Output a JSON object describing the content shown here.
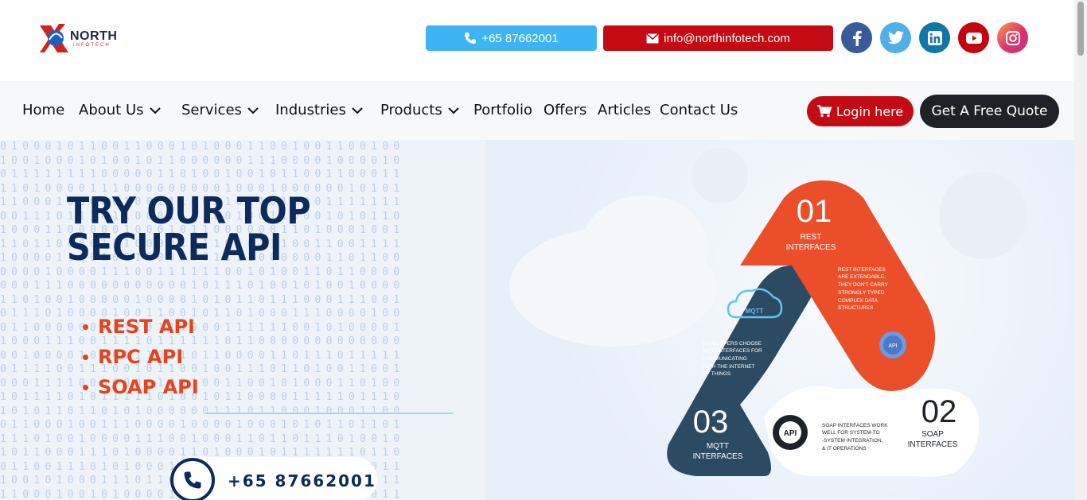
{
  "brand": {
    "logo_name": "NORTH",
    "logo_sub": "INFOTECH"
  },
  "contact": {
    "phone": "+65 87662001",
    "email": "info@northinfotech.com"
  },
  "social": [
    "facebook-icon",
    "twitter-icon",
    "linkedin-icon",
    "youtube-icon",
    "instagram-icon"
  ],
  "nav": {
    "items": [
      {
        "label": "Home",
        "dropdown": false
      },
      {
        "label": "About Us",
        "dropdown": true
      },
      {
        "label": "Services",
        "dropdown": true
      },
      {
        "label": "Industries",
        "dropdown": true
      },
      {
        "label": "Products",
        "dropdown": true
      },
      {
        "label": "Portfolio",
        "dropdown": false
      },
      {
        "label": "Offers",
        "dropdown": false
      },
      {
        "label": "Articles",
        "dropdown": false
      },
      {
        "label": "Contact Us",
        "dropdown": false
      }
    ],
    "login_label": "Login here",
    "quote_label": "Get A Free Quote"
  },
  "hero": {
    "title_line1": "TRY OUR TOP",
    "title_line2": "SECURE API",
    "api_list": [
      "REST API",
      "RPC API",
      "SOAP API"
    ],
    "phone": "+65 87662001",
    "infographic": {
      "step1": {
        "number": "01",
        "title_line1": "REST",
        "title_line2": "INTERFACES",
        "desc": [
          "REST INTERFACES",
          "ARE EXTENDABLE,",
          "THEY DON'T CARRY",
          "STRONGLY TYPED",
          "COMPLEX DATA",
          "STRUCTURES"
        ],
        "badge": "API"
      },
      "step2": {
        "number": "02",
        "title_line1": "SOAP",
        "title_line2": "INTERFACES",
        "desc": [
          "SOAP INTERFACES WORK",
          "WELL FOR SYSTEM-TO",
          "-SYSTEM INTEGRATION,",
          "& IT OPERATIONS"
        ],
        "badge": "API"
      },
      "step3": {
        "number": "03",
        "title_line1": "MQTT",
        "title_line2": "INTERFACES",
        "desc": [
          "DEVELOPERS CHOOSE",
          "MQTTINTERFACES FOR",
          "COMMUNICATING",
          "WITH THE INTERNET",
          "OF THINGS"
        ],
        "badge": "MQTT"
      }
    }
  },
  "colors": {
    "brand_red": "#c40a12",
    "sky": "#3db5f5",
    "navy": "#0c2a5c",
    "orange": "#e8421c",
    "slate": "#2d4a63"
  }
}
